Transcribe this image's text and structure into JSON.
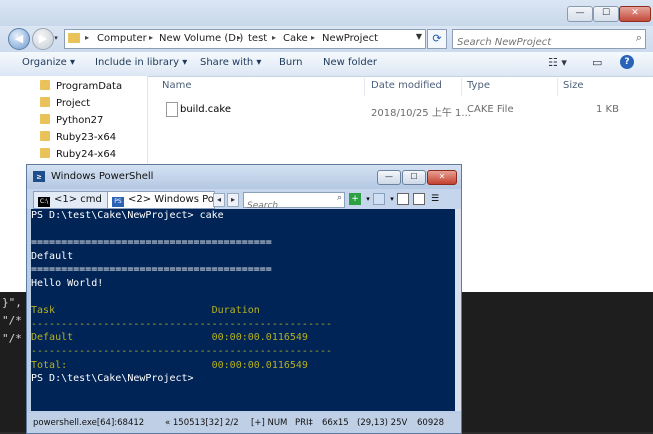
{
  "background_editor": {
    "lines": [
      "}\",",
      "\"/*",
      "\"/*"
    ]
  },
  "explorer": {
    "window_buttons": {
      "minimize": "—",
      "maximize": "☐",
      "close": "✕"
    },
    "address": {
      "crumbs": [
        "Computer",
        "New Volume (D:)",
        "test",
        "Cake",
        "NewProject"
      ],
      "separator": "▸"
    },
    "search_placeholder": "Search NewProject",
    "commands": [
      "Organize ▾",
      "Include in library ▾",
      "Share with ▾",
      "Burn",
      "New folder"
    ],
    "nav_items": [
      "ProgramData",
      "Project",
      "Python27",
      "Ruby23-x64",
      "Ruby24-x64"
    ],
    "columns": [
      "Name",
      "Date modified",
      "Type",
      "Size"
    ],
    "files": [
      {
        "name": "build.cake",
        "date": "2018/10/25 上午 1...",
        "type": "CAKE File",
        "size": "1 KB"
      }
    ]
  },
  "powershell": {
    "title": "Windows PowerShell",
    "window_buttons": {
      "minimize": "—",
      "maximize": "☐",
      "close": "✕"
    },
    "tabs": [
      {
        "icon": "C:\\",
        "label": "<1> cmd"
      },
      {
        "icon": "PS",
        "label": "<2> Windows Po"
      }
    ],
    "search_placeholder": "Search",
    "console_lines": [
      {
        "text": "PS D:\\test\\Cake\\NewProject> cake",
        "color": "#ffffff"
      },
      {
        "text": "",
        "color": "#ffffff"
      },
      {
        "text": "========================================",
        "color": "#ffffff"
      },
      {
        "text": "Default",
        "color": "#ffffff"
      },
      {
        "text": "========================================",
        "color": "#ffffff"
      },
      {
        "text": "Hello World!",
        "color": "#ffffff"
      },
      {
        "text": "",
        "color": "#ffffff"
      },
      {
        "text": "Task                          Duration",
        "color": "#b5b01f"
      },
      {
        "text": "--------------------------------------------------",
        "color": "#b5b01f"
      },
      {
        "text": "Default                       00:00:00.0116549",
        "color": "#b5b01f"
      },
      {
        "text": "--------------------------------------------------",
        "color": "#b5b01f"
      },
      {
        "text": "Total:                        00:00:00.0116549",
        "color": "#b5b01f"
      },
      {
        "text": "PS D:\\test\\Cake\\NewProject>",
        "color": "#ffffff"
      }
    ],
    "status": {
      "process": "powershell.exe[64]:68412",
      "buffer": "« 150513[32]",
      "panes": "2/2",
      "mode": "[+] NUM",
      "pri": "PRI‡",
      "size": "66x15",
      "cursor": "(29,13) 25V",
      "extra": "60928"
    }
  }
}
